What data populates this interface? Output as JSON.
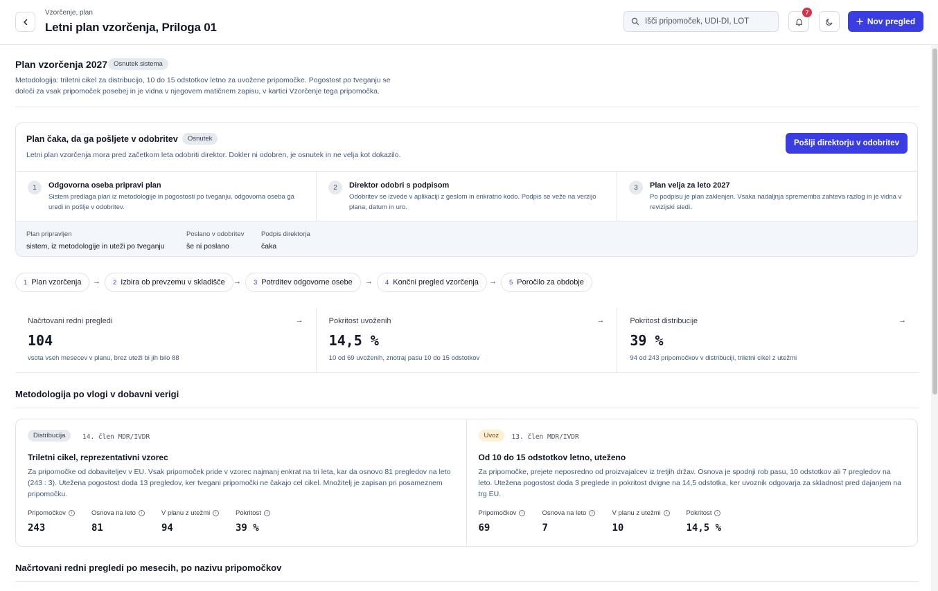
{
  "header": {
    "breadcrumb": "Vzorčenje, plan",
    "title": "Letni plan vzorčenja, Priloga 01",
    "search_placeholder": "Išči pripomoček, UDI-DI, LOT",
    "notifications_count": "7",
    "new_button": "Nov pregled"
  },
  "plan": {
    "title": "Plan vzorčenja 2027",
    "badge": "Osnutek sistema",
    "methodology": "Metodologija: triletni cikel za distribucijo, 10 do 15 odstotkov letno za uvožene pripomočke. Pogostost po tveganju se določi za vsak pripomoček posebej in je vidna v njegovem matičnem zapisu, v kartici Vzorčenje tega pripomočka."
  },
  "approval": {
    "title": "Plan čaka, da ga pošljete v odobritev",
    "badge": "Osnutek",
    "subtitle": "Letni plan vzorčenja mora pred začetkom leta odobriti direktor. Dokler ni odobren, je osnutek in ne velja kot dokazilo.",
    "send_button": "Pošlji direktorju v odobritev",
    "steps": [
      {
        "num": "1",
        "title": "Odgovorna oseba pripravi plan",
        "desc": "Sistem predlaga plan iz metodologije in pogostosti po tveganju, odgovorna oseba ga uredi in pošlje v odobritev."
      },
      {
        "num": "2",
        "title": "Direktor odobri s podpisom",
        "desc": "Odobritev se izvede v aplikaciji z geslom in enkratno kodo. Podpis se veže na verzijo plana, datum in uro."
      },
      {
        "num": "3",
        "title": "Plan velja za leto 2027",
        "desc": "Po podpisu je plan zaklenjen. Vsaka nadaljnja sprememba zahteva razlog in je vidna v revizijski sledi."
      }
    ],
    "meta": [
      {
        "label": "Plan pripravljen",
        "value": "sistem, iz metodologije in uteži po tveganju"
      },
      {
        "label": "Poslano v odobritev",
        "value": "še ni poslano"
      },
      {
        "label": "Podpis direktorja",
        "value": "čaka"
      }
    ]
  },
  "workflow": [
    {
      "num": "1",
      "label": "Plan vzorčenja"
    },
    {
      "num": "2",
      "label": "Izbira ob prevzemu v skladišče"
    },
    {
      "num": "3",
      "label": "Potrditev odgovorne osebe"
    },
    {
      "num": "4",
      "label": "Končni pregled vzorčenja"
    },
    {
      "num": "5",
      "label": "Poročilo za obdobje"
    }
  ],
  "stats": [
    {
      "label": "Načrtovani redni pregledi",
      "value": "104",
      "note": "vsota vseh mesecev v planu, brez uteži bi jih bilo 88"
    },
    {
      "label": "Pokritost uvoženih",
      "value": "14,5 %",
      "note": "10 od 69 uvoženih, znotraj pasu 10 do 15 odstotkov"
    },
    {
      "label": "Pokritost distribucije",
      "value": "39 %",
      "note": "94 od 243 pripomočkov v distribuciji, triletni cikel z utežmi"
    }
  ],
  "methodology_section": {
    "title": "Metodologija po vlogi v dobavni verigi",
    "columns": [
      {
        "badge": "Distribucija",
        "ref": "14. člen MDR/IVDR",
        "title": "Triletni cikel, reprezentativni vzorec",
        "desc": "Za pripomočke od dobaviteljev v EU. Vsak pripomoček pride v vzorec najmanj enkrat na tri leta, kar da osnovo 81 pregledov na leto (243 : 3). Utežena pogostost doda 13 pregledov, ker tvegani pripomočki ne čakajo cel cikel. Množitelj je zapisan pri posameznem pripomočku.",
        "kpis": [
          {
            "label": "Pripomočkov",
            "value": "243"
          },
          {
            "label": "Osnova na leto",
            "value": "81"
          },
          {
            "label": "V planu z utežmi",
            "value": "94"
          },
          {
            "label": "Pokritost",
            "value": "39 %"
          }
        ]
      },
      {
        "badge": "Uvoz",
        "ref": "13. člen MDR/IVDR",
        "title": "Od 10 do 15 odstotkov letno, uteženo",
        "desc": "Za pripomočke, prejete neposredno od proizvajalcev iz tretjih držav. Osnova je spodnji rob pasu, 10 odstotkov ali 7 pregledov na leto. Utežena pogostost doda 3 preglede in pokritost dvigne na 14,5 odstotka, ker uvoznik odgovarja za skladnost pred dajanjem na trg EU.",
        "kpis": [
          {
            "label": "Pripomočkov",
            "value": "69"
          },
          {
            "label": "Osnova na leto",
            "value": "7"
          },
          {
            "label": "V planu z utežmi",
            "value": "10"
          },
          {
            "label": "Pokritost",
            "value": "14,5 %"
          }
        ]
      }
    ]
  },
  "monthly_section": {
    "title": "Načrtovani redni pregledi po mesecih, po nazivu pripomočkov"
  },
  "colors": {
    "accent": "#3a3ee0",
    "badge_red": "#d6334a",
    "import_badge_bg": "#fdf0d5"
  }
}
